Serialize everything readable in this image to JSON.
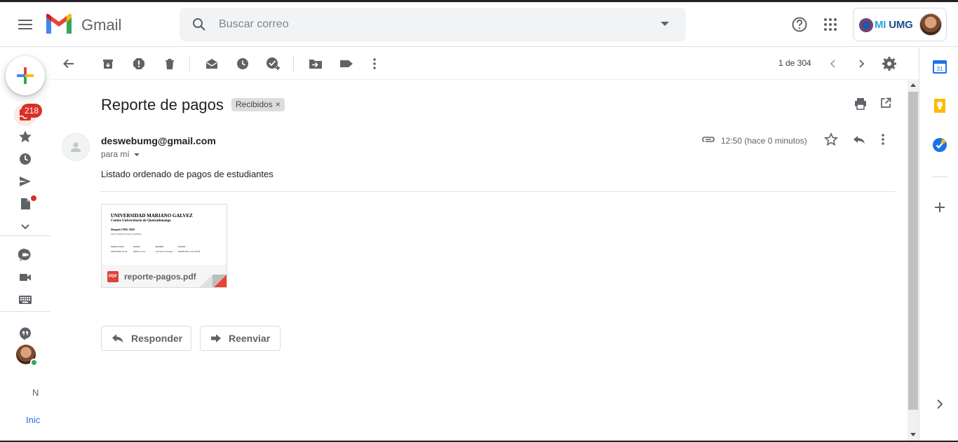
{
  "app": {
    "name": "Gmail"
  },
  "search": {
    "placeholder": "Buscar correo"
  },
  "account": {
    "org_prefix": "MI",
    "org_name": "UMG"
  },
  "nav": {
    "inbox_badge": "218",
    "more_initial": "N",
    "more_label": "Inic"
  },
  "toolbar": {
    "pager": "1 de 304"
  },
  "message": {
    "subject": "Reporte de pagos",
    "label": "Recibidos",
    "label_remove": "×",
    "sender": "deswebumg@gmail.com",
    "recipient": "para mí",
    "time": "12:50 (hace 0 minutos)",
    "body": "Listado ordenado de pagos de estudiantes"
  },
  "attachment": {
    "filename": "reporte-pagos.pdf",
    "type_badge": "PDF",
    "preview": {
      "title": "UNIVERSIDAD MARIANO GALVEZ",
      "subtitle": "Centro Universitario de Quetzaltenango",
      "heading": "Sinopsis UMG 2020",
      "description": "Lista ordenada de pagos de alumnos",
      "columns": [
        "Fecha y hora",
        "Carnet",
        "Nombre",
        "Cuenta"
      ],
      "row": [
        "28/05/2020 15:34",
        "0900-xx-xxxx",
        "Hermione Granger",
        "BANRURAL 123-12345"
      ]
    }
  },
  "actions": {
    "reply": "Responder",
    "forward": "Reenviar"
  },
  "side_panel": {
    "calendar_day": "31"
  },
  "colors": {
    "accent_red": "#d93025",
    "primary_blue": "#1a73e8",
    "online_green": "#34a853"
  }
}
